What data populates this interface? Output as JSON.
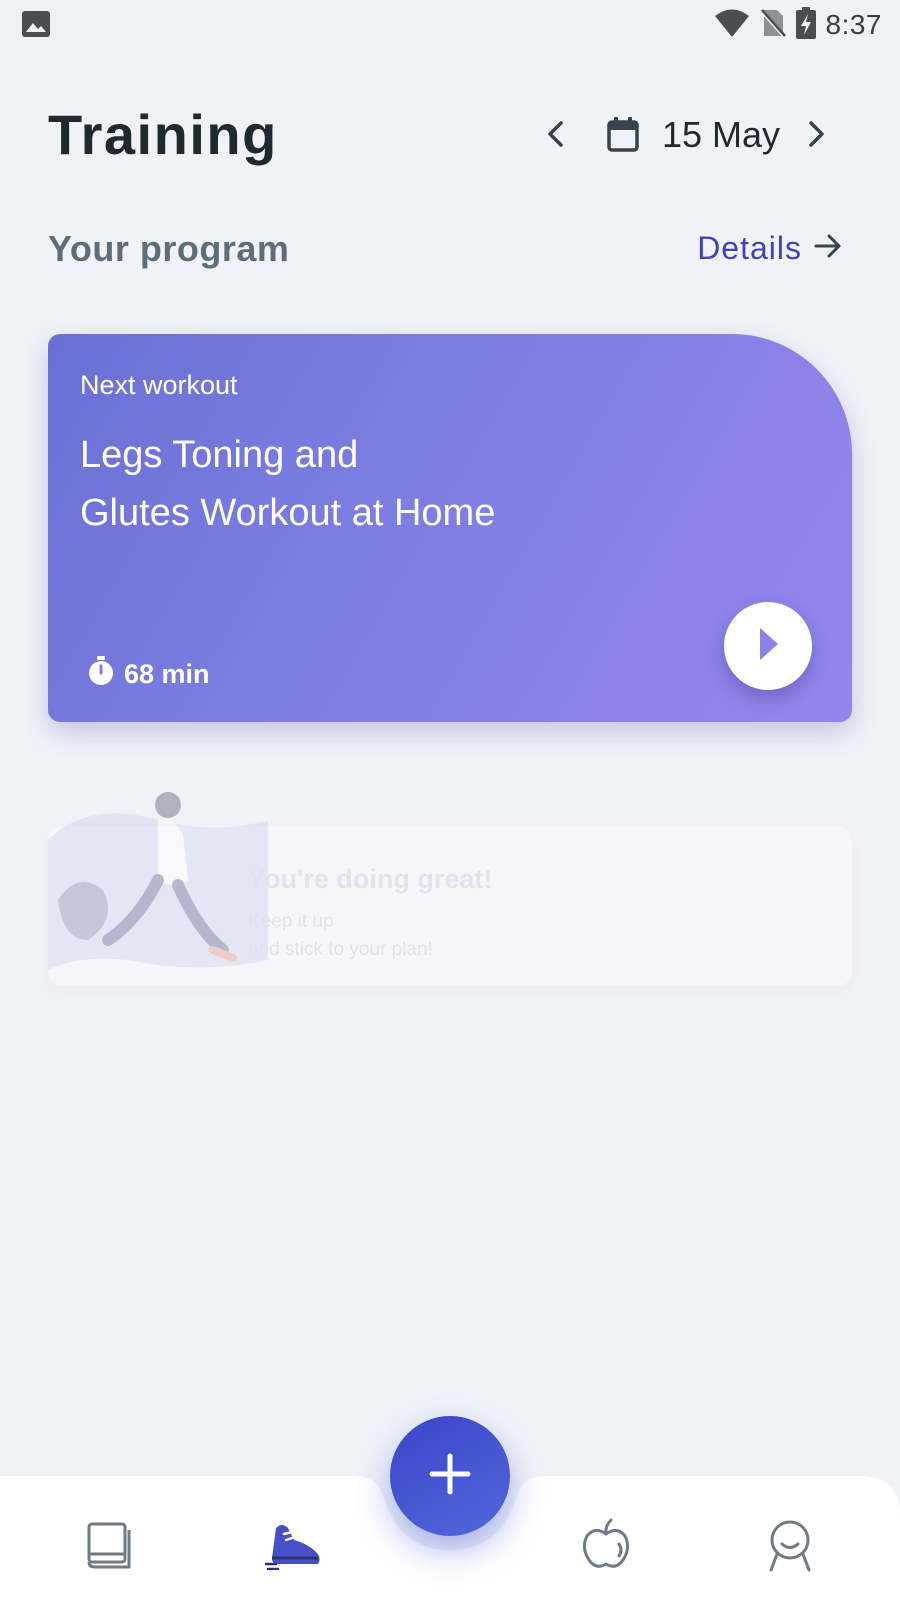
{
  "status_bar": {
    "time": "8:37",
    "icons": [
      "gallery-icon",
      "wifi-icon",
      "no-sim-icon",
      "battery-charging-icon"
    ]
  },
  "header": {
    "title": "Training",
    "date": "15 May",
    "prev_icon": "chevron-left-icon",
    "next_icon": "chevron-right-icon",
    "calendar_icon": "calendar-icon"
  },
  "program": {
    "section_title": "Your program",
    "details_label": "Details",
    "details_icon": "arrow-right-icon"
  },
  "workout_card": {
    "kicker": "Next workout",
    "title_lines": [
      "Legs Toning and",
      "Glutes Workout at Home"
    ],
    "duration": "68 min",
    "duration_icon": "stopwatch-icon",
    "play_icon": "play-icon",
    "colors": {
      "gradient_start": "#6a70d6",
      "gradient_end": "#9186ee"
    }
  },
  "motivation_card": {
    "title": "You're doing great!",
    "subtitle_lines": [
      "Keep it up",
      "and stick to your plan!"
    ]
  },
  "bottom_nav": {
    "items": [
      {
        "name": "journal",
        "icon": "book-icon",
        "active": false
      },
      {
        "name": "training",
        "icon": "sneaker-icon",
        "active": true
      },
      {
        "name": "nutrition",
        "icon": "apple-icon",
        "active": false
      },
      {
        "name": "profile",
        "icon": "profile-icon",
        "active": false
      }
    ],
    "fab_icon": "plus-icon",
    "colors": {
      "accent": "#3d44b5",
      "inactive": "#6f7a82"
    }
  }
}
